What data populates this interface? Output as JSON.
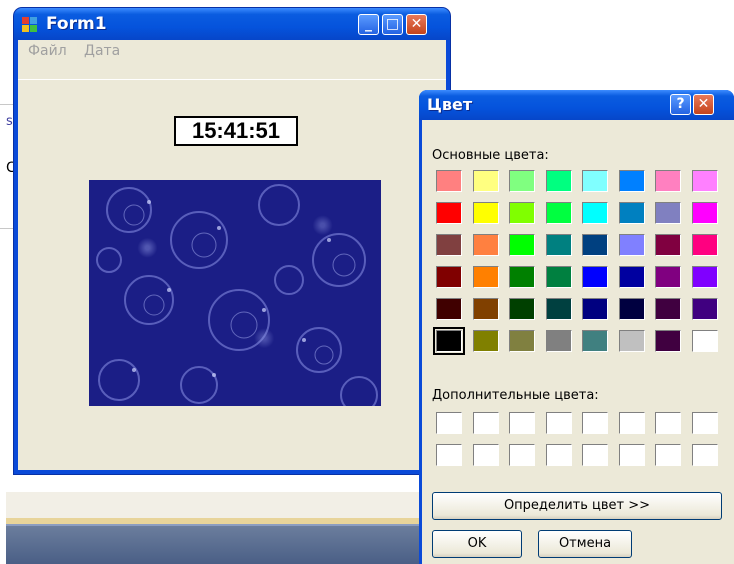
{
  "background": {
    "fragment_s": "s",
    "fragment_c": "C"
  },
  "form1": {
    "title": "Form1",
    "menu": [
      "Файл",
      "Дата"
    ],
    "clock_text": "15:41:51",
    "buttons": {
      "minimize": "_",
      "maximize": "□",
      "close": "✕"
    }
  },
  "color_dialog": {
    "title": "Цвет",
    "help_button": "?",
    "close_button": "✕",
    "basic_colors_label": "Основные цвета:",
    "custom_colors_label": "Дополнительные цвета:",
    "basic_colors": [
      [
        "#ff8080",
        "#ffff80",
        "#80ff80",
        "#00ff80",
        "#80ffff",
        "#0080ff",
        "#ff80c0",
        "#ff80ff"
      ],
      [
        "#ff0000",
        "#ffff00",
        "#80ff00",
        "#00ff40",
        "#00ffff",
        "#0080c0",
        "#8080c0",
        "#ff00ff"
      ],
      [
        "#804040",
        "#ff8040",
        "#00ff00",
        "#008080",
        "#004080",
        "#8080ff",
        "#800040",
        "#ff0080"
      ],
      [
        "#800000",
        "#ff8000",
        "#008000",
        "#008040",
        "#0000ff",
        "#0000a0",
        "#800080",
        "#8000ff"
      ],
      [
        "#400000",
        "#804000",
        "#004000",
        "#004040",
        "#000080",
        "#000040",
        "#400040",
        "#400080"
      ],
      [
        "#000000",
        "#808000",
        "#808040",
        "#808080",
        "#408080",
        "#c0c0c0",
        "#400040",
        "#ffffff"
      ]
    ],
    "selected_color": "#000000",
    "define_colors_button": "Определить цвет >>",
    "ok_button": "OK",
    "cancel_button": "Отмена"
  }
}
